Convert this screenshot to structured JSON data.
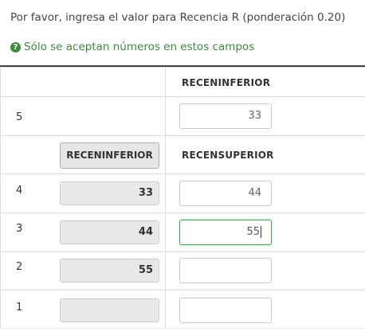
{
  "question": "Por favor, ingresa el valor para Recencia R (ponderación 0.20)",
  "tip": "Sólo se aceptan números en estos campos",
  "header": {
    "right_col": "RECENINFERIOR"
  },
  "first_row": {
    "label": "5",
    "value": "33"
  },
  "sub_header": {
    "button": "RECENINFERIOR",
    "right_col": "RECENSUPERIOR"
  },
  "rows": [
    {
      "label": "4",
      "lower": "33",
      "upper": "44"
    },
    {
      "label": "3",
      "lower": "44",
      "upper": "55"
    },
    {
      "label": "2",
      "lower": "55",
      "upper": ""
    },
    {
      "label": "1",
      "lower": "",
      "upper": ""
    }
  ],
  "colors": {
    "tip_green": "#3c8c3c",
    "focus_border": "#4aa85a"
  }
}
